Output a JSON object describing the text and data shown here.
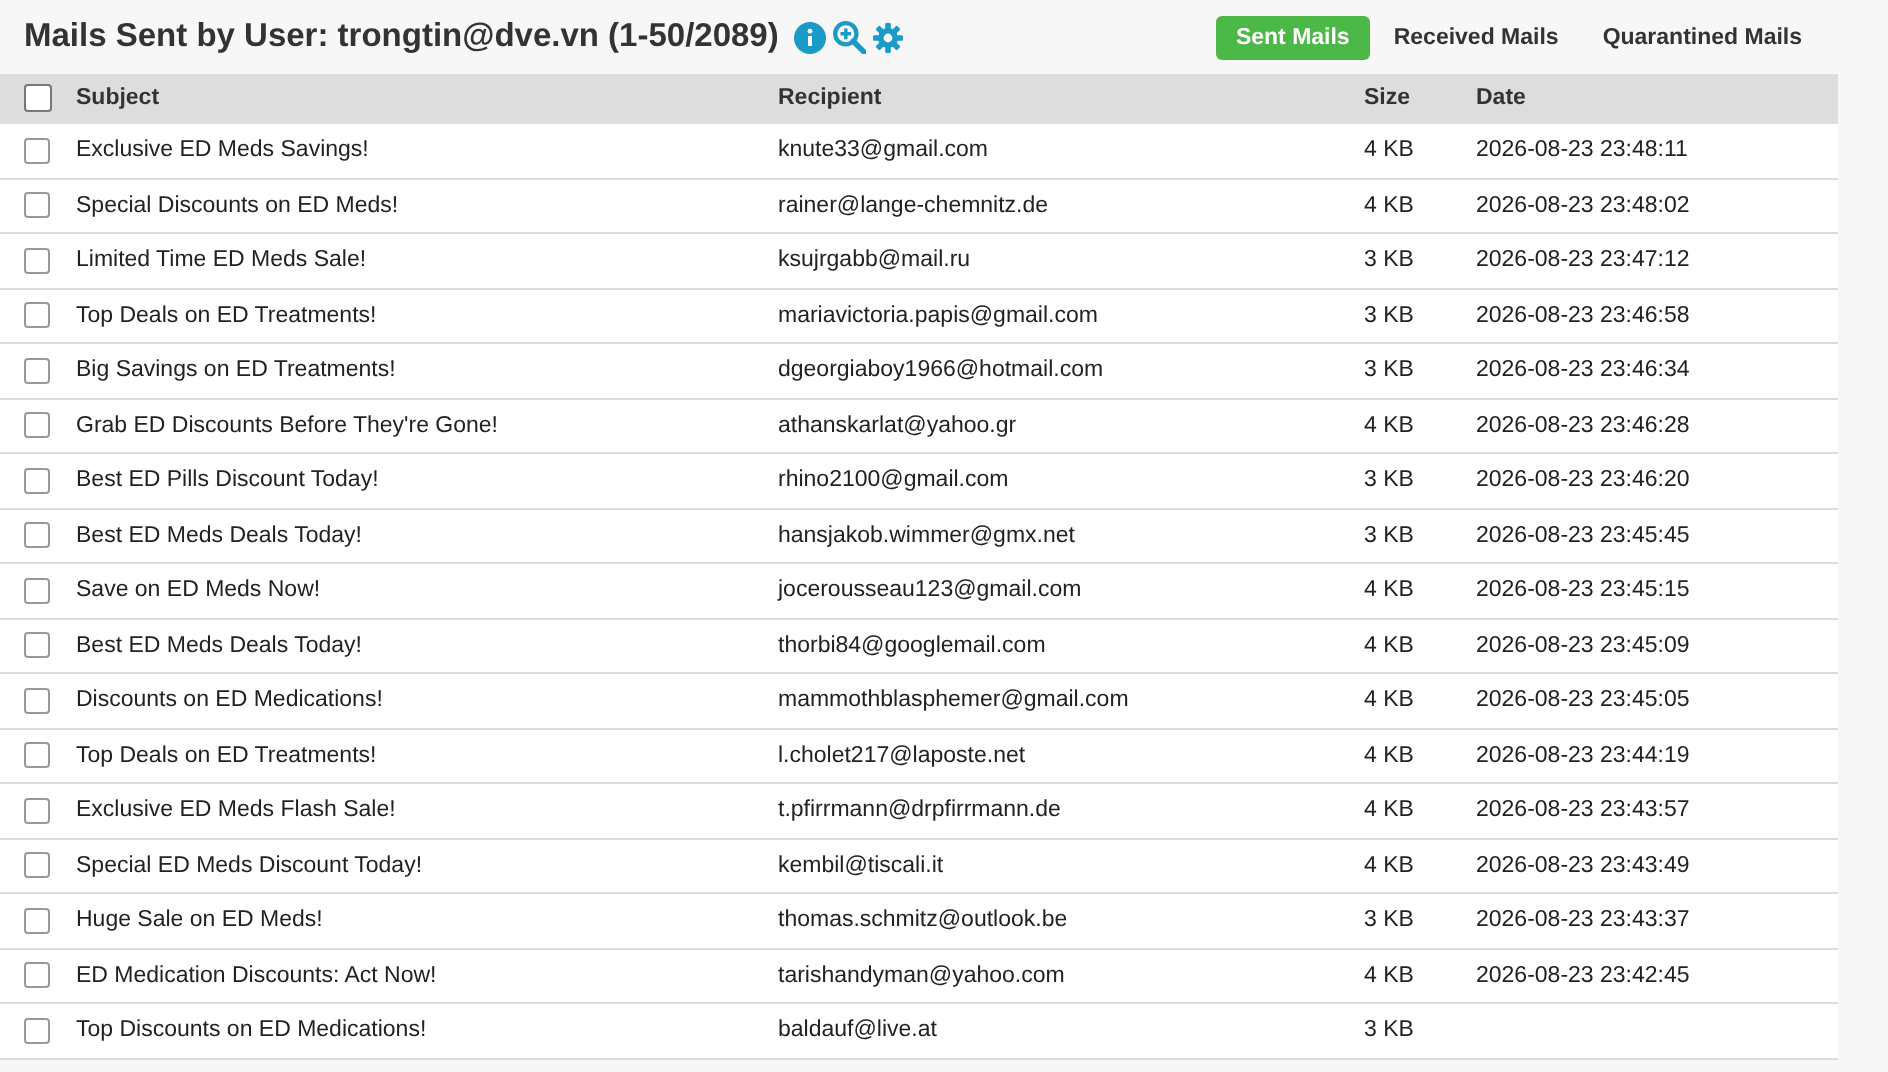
{
  "title": "Mails Sent by User: trongtin@dve.vn (1-50/2089)",
  "tabs": [
    {
      "label": "Sent Mails",
      "selected": true
    },
    {
      "label": "Received Mails",
      "selected": false
    },
    {
      "label": "Quarantined Mails",
      "selected": false
    }
  ],
  "table": {
    "select_all_checked": false,
    "columns": [
      "Subject",
      "Recipient",
      "Size",
      "Date"
    ],
    "rows": [
      {
        "checked": false,
        "subject": "Exclusive ED Meds Savings!",
        "recipient": "knute33@gmail.com",
        "size": "4 KB",
        "date": "2026-08-23 23:48:11"
      },
      {
        "checked": false,
        "subject": "Special Discounts on ED Meds!",
        "recipient": "rainer@lange-chemnitz.de",
        "size": "4 KB",
        "date": "2026-08-23 23:48:02"
      },
      {
        "checked": false,
        "subject": "Limited Time ED Meds Sale!",
        "recipient": "ksujrgabb@mail.ru",
        "size": "3 KB",
        "date": "2026-08-23 23:47:12"
      },
      {
        "checked": false,
        "subject": "Top Deals on ED Treatments!",
        "recipient": "mariavictoria.papis@gmail.com",
        "size": "3 KB",
        "date": "2026-08-23 23:46:58"
      },
      {
        "checked": false,
        "subject": "Big Savings on ED Treatments!",
        "recipient": "dgeorgiaboy1966@hotmail.com",
        "size": "3 KB",
        "date": "2026-08-23 23:46:34"
      },
      {
        "checked": false,
        "subject": "Grab ED Discounts Before They're Gone!",
        "recipient": "athanskarlat@yahoo.gr",
        "size": "4 KB",
        "date": "2026-08-23 23:46:28"
      },
      {
        "checked": false,
        "subject": "Best ED Pills Discount Today!",
        "recipient": "rhino2100@gmail.com",
        "size": "3 KB",
        "date": "2026-08-23 23:46:20"
      },
      {
        "checked": false,
        "subject": "Best ED Meds Deals Today!",
        "recipient": "hansjakob.wimmer@gmx.net",
        "size": "3 KB",
        "date": "2026-08-23 23:45:45"
      },
      {
        "checked": false,
        "subject": "Save on ED Meds Now!",
        "recipient": "jocerousseau123@gmail.com",
        "size": "4 KB",
        "date": "2026-08-23 23:45:15"
      },
      {
        "checked": false,
        "subject": "Best ED Meds Deals Today!",
        "recipient": "thorbi84@googlemail.com",
        "size": "4 KB",
        "date": "2026-08-23 23:45:09"
      },
      {
        "checked": false,
        "subject": "Discounts on ED Medications!",
        "recipient": "mammothblasphemer@gmail.com",
        "size": "4 KB",
        "date": "2026-08-23 23:45:05"
      },
      {
        "checked": false,
        "subject": "Top Deals on ED Treatments!",
        "recipient": "l.cholet217@laposte.net",
        "size": "4 KB",
        "date": "2026-08-23 23:44:19"
      },
      {
        "checked": false,
        "subject": "Exclusive ED Meds Flash Sale!",
        "recipient": "t.pfirrmann@drpfirrmann.de",
        "size": "4 KB",
        "date": "2026-08-23 23:43:57"
      },
      {
        "checked": false,
        "subject": "Special ED Meds Discount Today!",
        "recipient": "kembil@tiscali.it",
        "size": "4 KB",
        "date": "2026-08-23 23:43:49"
      },
      {
        "checked": false,
        "subject": "Huge Sale on ED Meds!",
        "recipient": "thomas.schmitz@outlook.be",
        "size": "3 KB",
        "date": "2026-08-23 23:43:37"
      },
      {
        "checked": false,
        "subject": "ED Medication Discounts: Act Now!",
        "recipient": "tarishandyman@yahoo.com",
        "size": "4 KB",
        "date": "2026-08-23 23:42:45"
      },
      {
        "checked": false,
        "subject": "Top Discounts on ED Medications!",
        "recipient": "baldauf@live.at",
        "size": "3 KB"
      }
    ]
  }
}
